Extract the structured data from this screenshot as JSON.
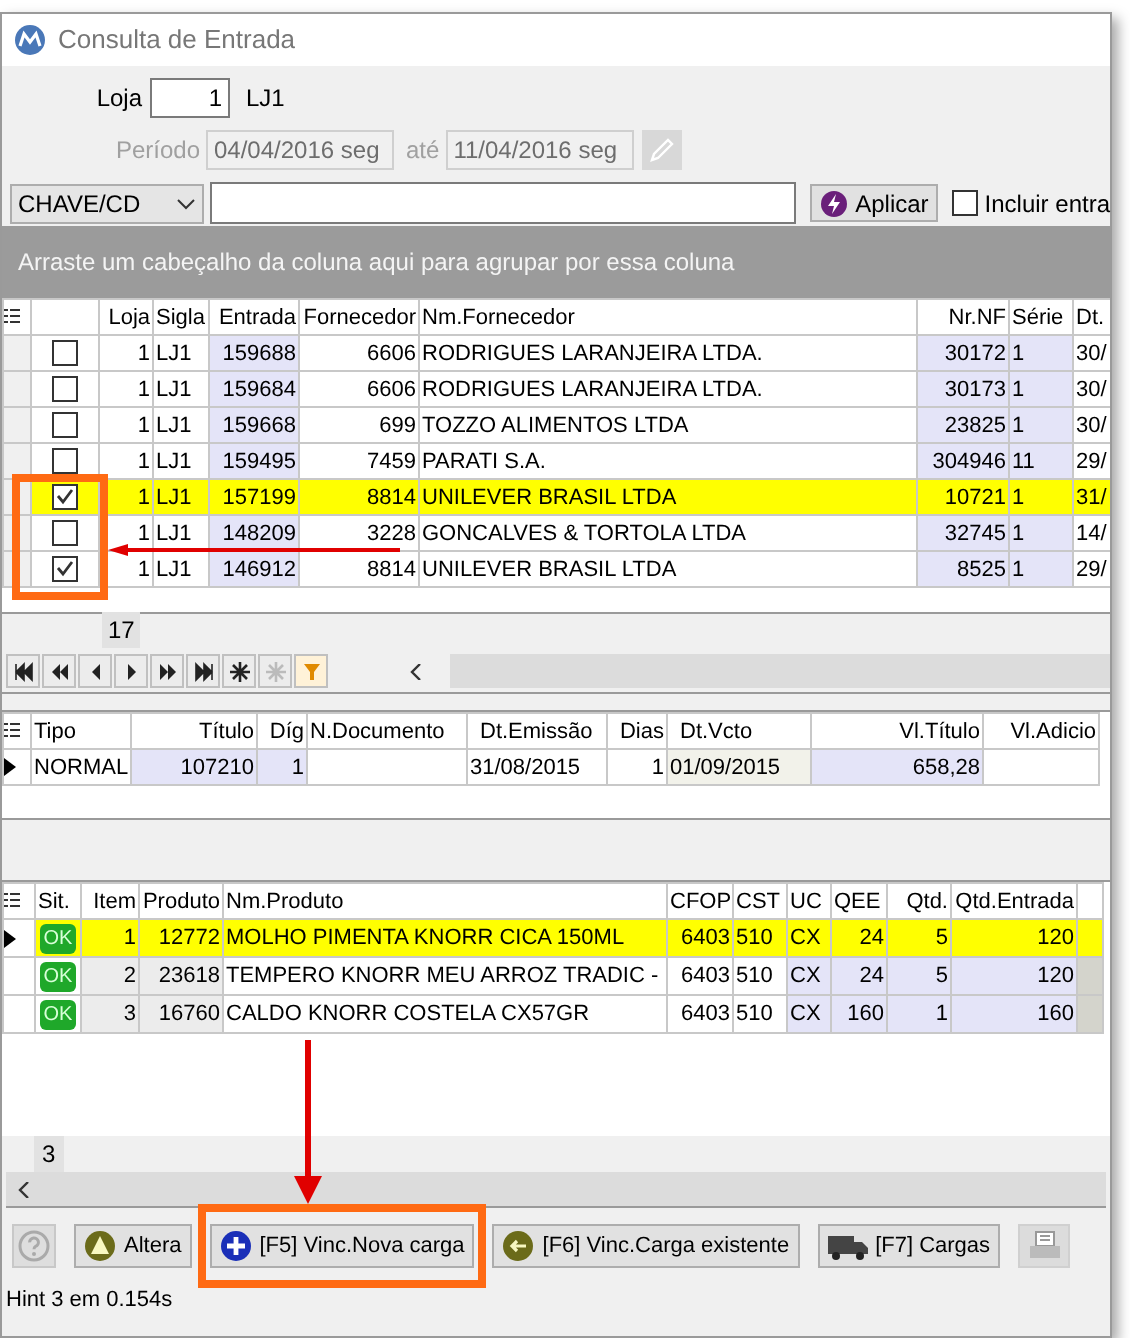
{
  "window": {
    "title": "Consulta de Entrada"
  },
  "filters": {
    "loja_label": "Loja",
    "loja_value": "1",
    "loja_name": "LJ1",
    "periodo_label": "Período",
    "periodo_start": "04/04/2016 seg",
    "ate_label": "até",
    "periodo_end": "11/04/2016 seg",
    "periodo_disabled": true,
    "search_field": "CHAVE/CD",
    "apply_button": "Aplicar",
    "include_checkbox": {
      "label": "Incluir entra",
      "checked": false
    }
  },
  "group_panel_hint": "Arraste um cabeçalho da coluna aqui para agrupar por essa coluna",
  "entries_table": {
    "columns": [
      "Loja",
      "Sigla",
      "Entrada",
      "Fornecedor",
      "Nm.Fornecedor",
      "Nr.NF",
      "Série",
      "Dt."
    ],
    "rows": [
      {
        "checked": false,
        "selected": false,
        "cells": [
          "1",
          "LJ1",
          "159688",
          "6606",
          "RODRIGUES LARANJEIRA LTDA.",
          "30172",
          "1",
          "30/"
        ]
      },
      {
        "checked": false,
        "selected": false,
        "cells": [
          "1",
          "LJ1",
          "159684",
          "6606",
          "RODRIGUES LARANJEIRA LTDA.",
          "30173",
          "1",
          "30/"
        ]
      },
      {
        "checked": false,
        "selected": false,
        "cells": [
          "1",
          "LJ1",
          "159668",
          "699",
          "TOZZO ALIMENTOS LTDA",
          "23825",
          "1",
          "30/"
        ]
      },
      {
        "checked": false,
        "selected": false,
        "cells": [
          "1",
          "LJ1",
          "159495",
          "7459",
          "PARATI S.A.",
          "304946",
          "11",
          "29/"
        ]
      },
      {
        "checked": true,
        "selected": true,
        "cells": [
          "1",
          "LJ1",
          "157199",
          "8814",
          "UNILEVER BRASIL LTDA",
          "10721",
          "1",
          "31/"
        ]
      },
      {
        "checked": false,
        "selected": false,
        "cells": [
          "1",
          "LJ1",
          "148209",
          "3228",
          "GONCALVES & TORTOLA LTDA",
          "32745",
          "1",
          "14/"
        ]
      },
      {
        "checked": true,
        "selected": false,
        "cells": [
          "1",
          "LJ1",
          "146912",
          "8814",
          "UNILEVER BRASIL LTDA",
          "8525",
          "1",
          "29/"
        ]
      }
    ],
    "footer_count": "17"
  },
  "titles_table": {
    "columns": [
      "Tipo",
      "Título",
      "Díg",
      "N.Documento",
      "Dt.Emissão",
      "Dias",
      "Dt.Vcto",
      "Vl.Título",
      "Vl.Adicio"
    ],
    "rows": [
      {
        "current": true,
        "cells": [
          "NORMAL",
          "107210",
          "1",
          "",
          "31/08/2015",
          "1",
          "01/09/2015",
          "658,28",
          ""
        ]
      }
    ]
  },
  "items_table": {
    "columns": [
      "Sit.",
      "Item",
      "Produto",
      "Nm.Produto",
      "CFOP",
      "CST",
      "UC",
      "QEE",
      "Qtd.",
      "Qtd.Entrada"
    ],
    "rows": [
      {
        "current": true,
        "selected": true,
        "cells": [
          "OK",
          "1",
          "12772",
          "MOLHO PIMENTA KNORR CICA 150ML",
          "6403",
          "510",
          "CX",
          "24",
          "5",
          "120"
        ]
      },
      {
        "current": false,
        "selected": false,
        "cells": [
          "OK",
          "2",
          "23618",
          "TEMPERO KNORR MEU ARROZ TRADIC -",
          "6403",
          "510",
          "CX",
          "24",
          "5",
          "120"
        ]
      },
      {
        "current": false,
        "selected": false,
        "cells": [
          "OK",
          "3",
          "16760",
          "CALDO KNORR COSTELA CX57GR",
          "6403",
          "510",
          "CX",
          "160",
          "1",
          "160"
        ]
      }
    ],
    "footer_count": "3"
  },
  "buttons": [
    {
      "kind": "edit",
      "label": "Altera",
      "disabled": false
    },
    {
      "kind": "new",
      "label": "[F5] Vinc.Nova carga",
      "disabled": false
    },
    {
      "kind": "link",
      "label": "[F6] Vinc.Carga existente",
      "disabled": false
    },
    {
      "kind": "truck",
      "label": "[F7] Cargas",
      "disabled": false
    },
    {
      "kind": "print",
      "disabled": true
    }
  ],
  "status_bar": "Hint 3 em 0.154s"
}
